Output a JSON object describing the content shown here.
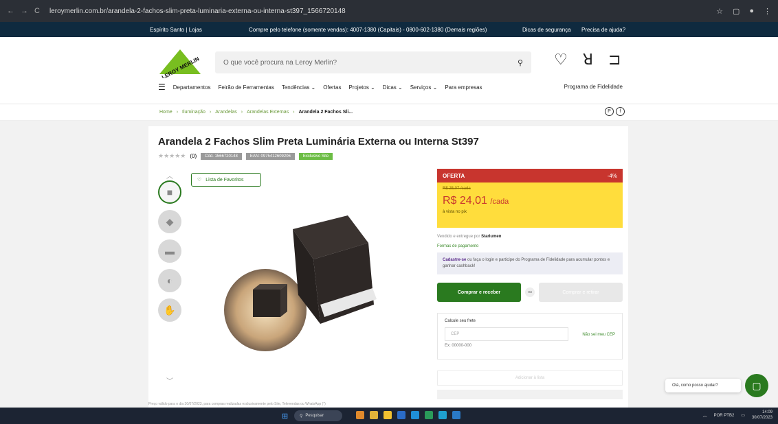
{
  "browser": {
    "url": "leroymerlin.com.br/arandela-2-fachos-slim-preta-luminaria-externa-ou-interna-st397_1566720148",
    "back": "←",
    "forward": "→",
    "reload": "C"
  },
  "topstrip": {
    "location": "Espírito Santo | Lojas",
    "phone": "Compre pelo telefone (somente vendas): 4007-1380 (Capitais) - 0800-602-1380 (Demais regiões)",
    "security": "Dicas de segurança",
    "help": "Precisa de ajuda?"
  },
  "header": {
    "logo_text": "LEROY MERLIN",
    "search_placeholder": "O que você procura na Leroy Merlin?",
    "menu": [
      "Departamentos",
      "Feirão de Ferramentas",
      "Tendências ⌄",
      "Ofertas",
      "Projetos ⌄",
      "Dicas ⌄",
      "Serviços ⌄",
      "Para empresas"
    ],
    "loyalty": "Programa de Fidelidade"
  },
  "breadcrumb": {
    "items": [
      "Home",
      "Iluminação",
      "Arandelas",
      "Arandelas Externas"
    ],
    "current": "Arandela 2 Fachos Sli..."
  },
  "product": {
    "title": "Arandela 2 Fachos Slim Preta Luminária Externa ou Interna St397",
    "reviews": "(0)",
    "tags": [
      "Cód. 1566720148",
      "EAN: 0975412609206",
      "Exclusivo Site"
    ],
    "favorite": "Lista de Favoritos",
    "disclaimer": "Preço válido para o dia 30/07/2023, para compras realizadas exclusivamente pelo Site, Televendas ou WhatsApp (*)"
  },
  "offer": {
    "label": "OFERTA",
    "discount": "-4%",
    "old_price": "R$ 25,07 /cada",
    "price": "R$ 24,01",
    "unit": "/cada",
    "payment_note": "à vista no pix",
    "seller_label": "Vendido e entregue por",
    "seller": "Starlumen",
    "payment_forms": "Formas de pagamento",
    "loyalty_signup": "Cadastre-se",
    "loyalty_text": "ou faça o login e participe do Programa de Fidelidade para acumular pontos e ganhar cashback!",
    "buy": "Comprar e receber",
    "or": "ou",
    "pickup": "Comprar e retirar",
    "freight_label": "Calcule seu frete",
    "cep_placeholder": "CEP",
    "no_cep": "Não sei meu CEP",
    "cep_example": "Ex: 00000-000",
    "extra": "Adicionar à lista"
  },
  "chat": {
    "bubble": "Olá, como posso ajudar?"
  },
  "taskbar": {
    "search": "Pesquisar",
    "lang": "POR PTB2",
    "time": "14:09",
    "date": "30/07/2023"
  }
}
